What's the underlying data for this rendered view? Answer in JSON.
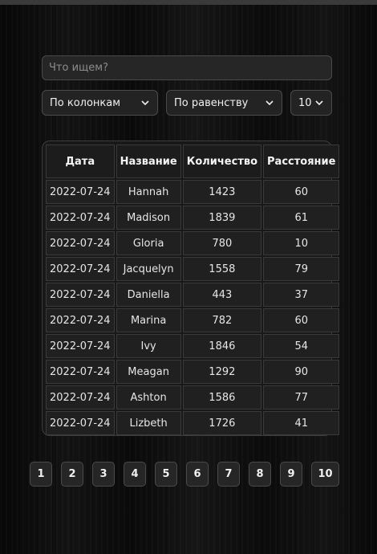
{
  "search": {
    "placeholder": "Что ищем?",
    "value": ""
  },
  "filters": {
    "column": {
      "selected": "По колонкам"
    },
    "mode": {
      "selected": "По равенству"
    },
    "page_size": {
      "selected": "10"
    }
  },
  "table": {
    "headers": [
      "Дата",
      "Название",
      "Количество",
      "Расстояние"
    ],
    "rows": [
      [
        "2022-07-24",
        "Hannah",
        "1423",
        "60"
      ],
      [
        "2022-07-24",
        "Madison",
        "1839",
        "61"
      ],
      [
        "2022-07-24",
        "Gloria",
        "780",
        "10"
      ],
      [
        "2022-07-24",
        "Jacquelyn",
        "1558",
        "79"
      ],
      [
        "2022-07-24",
        "Daniella",
        "443",
        "37"
      ],
      [
        "2022-07-24",
        "Marina",
        "782",
        "60"
      ],
      [
        "2022-07-24",
        "Ivy",
        "1846",
        "54"
      ],
      [
        "2022-07-24",
        "Meagan",
        "1292",
        "90"
      ],
      [
        "2022-07-24",
        "Ashton",
        "1586",
        "77"
      ],
      [
        "2022-07-24",
        "Lizbeth",
        "1726",
        "41"
      ]
    ]
  },
  "pagination": {
    "pages": [
      "1",
      "2",
      "3",
      "4",
      "5",
      "6",
      "7",
      "8",
      "9",
      "10"
    ]
  },
  "icons": {
    "select_arrow": "chevron-down-icon"
  },
  "colors": {
    "background": "#0b0b0b",
    "control": "#232323",
    "border": "#4a4a4a",
    "text": "#f0f0f0"
  }
}
